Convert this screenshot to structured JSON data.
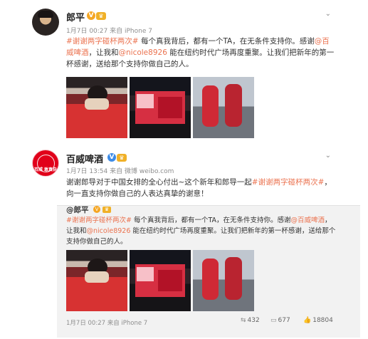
{
  "post1": {
    "user_name": "郎平",
    "meta": "1月7日 00:27 来自 iPhone 7",
    "text": {
      "tag": "#谢谢两字碰杯两次#",
      "part1": " 每个真我背后，都有一个TA，在无条件支持你。感谢",
      "mention1": "@百威啤酒",
      "part2": "，让我和",
      "mention2": "@nicole8926",
      "part3": " 能在纽约时代广场再度重聚。让我们把新年的第一杯感谢，送给那个支持你做自己的人。"
    }
  },
  "post2": {
    "user_name": "百威啤酒",
    "avatar_text": "百威 敢真自",
    "meta": "1月7日 13:54 来自 微博 weibo.com",
    "text": {
      "part1": "谢谢郎导对于中国女排的全心付出~这个新年和郎导一起",
      "tag": "#谢谢两字碰杯两次#",
      "part2": "，向一直支持你做自己的人表达真挚的谢意！"
    }
  },
  "repost": {
    "user_name": "@郎平",
    "text": {
      "tag": "#谢谢两字碰杯两次#",
      "part1": " 每个真我背后，都有一个TA，在无条件支持你。感谢",
      "mention1": "@百威啤酒",
      "part2": "，让我和",
      "mention2": "@nicole8926",
      "part3": " 能在纽约时代广场再度重聚。让我们把新年的第一杯感谢，送给那个支持你做自己的人。"
    },
    "meta": "1月7日 00:27 来自 iPhone 7",
    "actions": {
      "repost_count": "432",
      "comment_count": "677",
      "like_count": "18804"
    }
  },
  "icons": {
    "verified": "verified-badge-icon",
    "vip": "vip-crown-icon",
    "more": "chevron-down-icon",
    "repost": "repost-icon",
    "comment": "comment-icon",
    "like": "like-icon"
  },
  "colors": {
    "link": "#eb7350",
    "gold_badge": "#f5a623",
    "blue_badge": "#3d8be6",
    "brand_red": "#e1001a"
  }
}
